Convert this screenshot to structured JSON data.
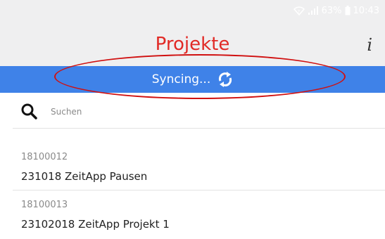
{
  "status_bar": {
    "battery_percent": "63%",
    "time": "10:43"
  },
  "header": {
    "title": "Projekte",
    "info_label": "i"
  },
  "sync": {
    "label": "Syncing..."
  },
  "search": {
    "placeholder": "Suchen"
  },
  "projects": [
    {
      "number": "18100012",
      "name": "231018 ZeitApp Pausen"
    },
    {
      "number": "18100013",
      "name": "23102018 ZeitApp Projekt 1"
    }
  ],
  "colors": {
    "title": "#e12a26",
    "sync_bar": "#3f82e8",
    "annotation": "#d01010",
    "header_bg": "#efeff0"
  }
}
